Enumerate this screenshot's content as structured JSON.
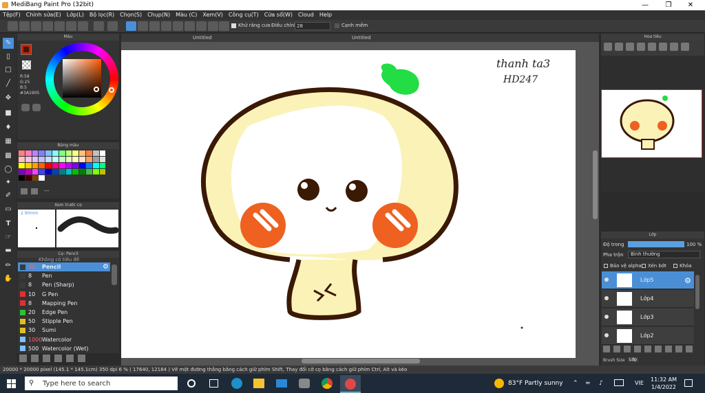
{
  "app": {
    "title": "MediBang Paint Pro (32bit)"
  },
  "menu": [
    "Tệp(F)",
    "Chỉnh sửa(E)",
    "Lớp(L)",
    "Bộ lọc(R)",
    "Chọn(S)",
    "Chụp(N)",
    "Màu (C)",
    "Xem(V)",
    "Công cụ(T)",
    "Cửa sổ(W)",
    "Cloud",
    "Help"
  ],
  "toolbar": {
    "antialias_label": "Khử răng cưa",
    "adjust_label": "Điều chỉnh",
    "adjust_value": "28",
    "snap_label": "Cạnh mềm"
  },
  "color_panel": {
    "title": "Màu",
    "r": "R:58",
    "g": "G:25",
    "b": "B:5",
    "hex": "#3A1905",
    "fg_color": "#3a1905",
    "bg_color": "#cc2200"
  },
  "palette_panel": {
    "title": "Bảng màu",
    "dots": "---",
    "colors": [
      "#ff8080",
      "#ff80c0",
      "#c080ff",
      "#8080ff",
      "#80c0ff",
      "#80ffff",
      "#80ff80",
      "#c0ff80",
      "#ffff80",
      "#ffc080",
      "#ff8040",
      "#c0c0c0",
      "#ffffff",
      "#ffc0c0",
      "#ffc0e0",
      "#e0c0ff",
      "#c0c0ff",
      "#c0e0ff",
      "#c0ffff",
      "#c0ffc0",
      "#e0ffc0",
      "#ffffc0",
      "#ffe0c0",
      "#ffa060",
      "#a0a0a0",
      "#e0e0e0",
      "#ffff00",
      "#ffd000",
      "#ffa000",
      "#ff6000",
      "#ff0000",
      "#ff0080",
      "#ff00ff",
      "#c000ff",
      "#8000ff",
      "#0000ff",
      "#0080ff",
      "#00ffff",
      "#00ff80",
      "#8000c0",
      "#c000c0",
      "#ff40ff",
      "#4040ff",
      "#0000c0",
      "#0040c0",
      "#008080",
      "#00c0c0",
      "#00c000",
      "#008000",
      "#40c040",
      "#80ff00",
      "#c0c000",
      "#000000",
      "#400000",
      "#804000",
      "#ffffff"
    ]
  },
  "brush_preview": {
    "title": "Xem trước cọ",
    "size": "2.90mm"
  },
  "brush_panel": {
    "title": "Cọ: Pencil",
    "top_label": "Không có tiêu đề",
    "brushes": [
      {
        "size": "40",
        "name": "Pencil",
        "color": "#3a3a3a",
        "active": true
      },
      {
        "size": "8",
        "name": "Pen",
        "color": "#3a3a3a"
      },
      {
        "size": "8",
        "name": "Pen (Sharp)",
        "color": "#3a3a3a"
      },
      {
        "size": "10",
        "name": "G Pen",
        "color": "#e03030"
      },
      {
        "size": "8",
        "name": "Mapping Pen",
        "color": "#e03030"
      },
      {
        "size": "20",
        "name": "Edge Pen",
        "color": "#30c030"
      },
      {
        "size": "50",
        "name": "Stipple Pen",
        "color": "#e0c020"
      },
      {
        "size": "30",
        "name": "Sumi",
        "color": "#e0c020"
      },
      {
        "size": "1000",
        "name": "Watercolor",
        "color": "#80c0ff"
      },
      {
        "size": "500",
        "name": "Watercolor (Wet)",
        "color": "#80c0ff"
      }
    ]
  },
  "tabs": [
    "Untitled",
    "Untitled"
  ],
  "canvas_text": {
    "line1": "thanh ta3",
    "line2": "HD247"
  },
  "navigator": {
    "title": "Hoa tiêu"
  },
  "layer_panel": {
    "title": "Lớp",
    "opacity_label": "Độ trong",
    "opacity_value": "100 %",
    "opacity_percent": 100,
    "blend_label": "Pha trộn",
    "blend_value": "Bình thường",
    "protect_alpha": "Bảo vệ alpha",
    "clipping": "Xén bớt",
    "lock": "Khóa",
    "layers": [
      "Lớp5",
      "Lớp4",
      "Lớp3",
      "Lớp2"
    ],
    "bottom_tabs": [
      "Brush Size",
      "Lớp"
    ]
  },
  "status": "20000 * 20000 pixel   (145.1 * 145.1cm)   350 dpi   6 %   ( 17640, 12184 )   Vẽ một đường thẳng bằng cách giữ phím Shift, Thay đổi cỡ cọ bằng cách giữ phím Ctrl, Alt và kéo",
  "taskbar": {
    "search_placeholder": "Type here to search",
    "weather": "83°F  Partly sunny",
    "lang": "VIE",
    "time": "11:32 AM",
    "date": "1/4/2022"
  }
}
